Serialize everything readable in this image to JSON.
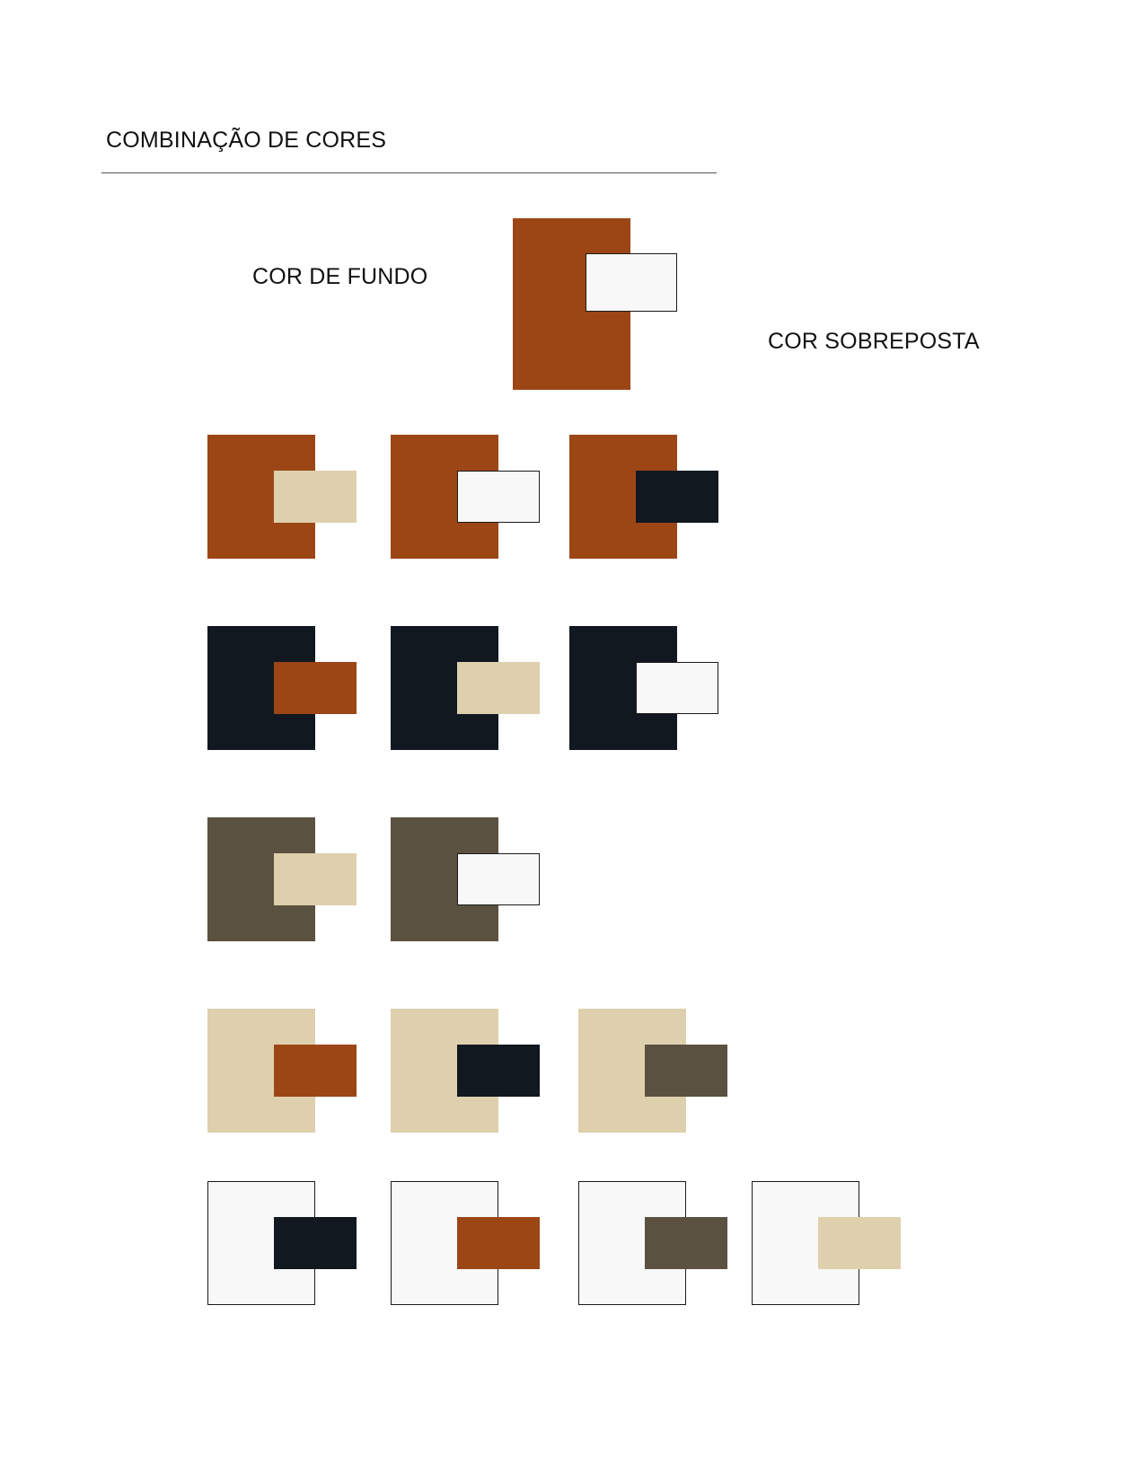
{
  "header": {
    "title": "COMBINAÇÃO DE CORES"
  },
  "legend": {
    "background_label": "COR DE FUNDO",
    "overlay_label": "COR SOBREPOSTA",
    "background_color": "#9c4616",
    "overlay_color": "#f8f8f8"
  },
  "palette": {
    "rust": "#9c4616",
    "navy": "#111820",
    "olive": "#5b5140",
    "sand": "#ded0ad",
    "white": "#f8f8f8"
  },
  "combinations": [
    {
      "background": "#9c4616",
      "overlays": [
        "#ded0ad",
        "#f8f8f8",
        "#111820"
      ]
    },
    {
      "background": "#111820",
      "overlays": [
        "#9c4616",
        "#ded0ad",
        "#f8f8f8"
      ]
    },
    {
      "background": "#5b5140",
      "overlays": [
        "#ded0ad",
        "#f8f8f8"
      ]
    },
    {
      "background": "#ded0ad",
      "overlays": [
        "#9c4616",
        "#111820",
        "#5b5140"
      ]
    },
    {
      "background": "#f8f8f8",
      "overlays": [
        "#111820",
        "#9c4616",
        "#5b5140",
        "#ded0ad"
      ]
    }
  ]
}
